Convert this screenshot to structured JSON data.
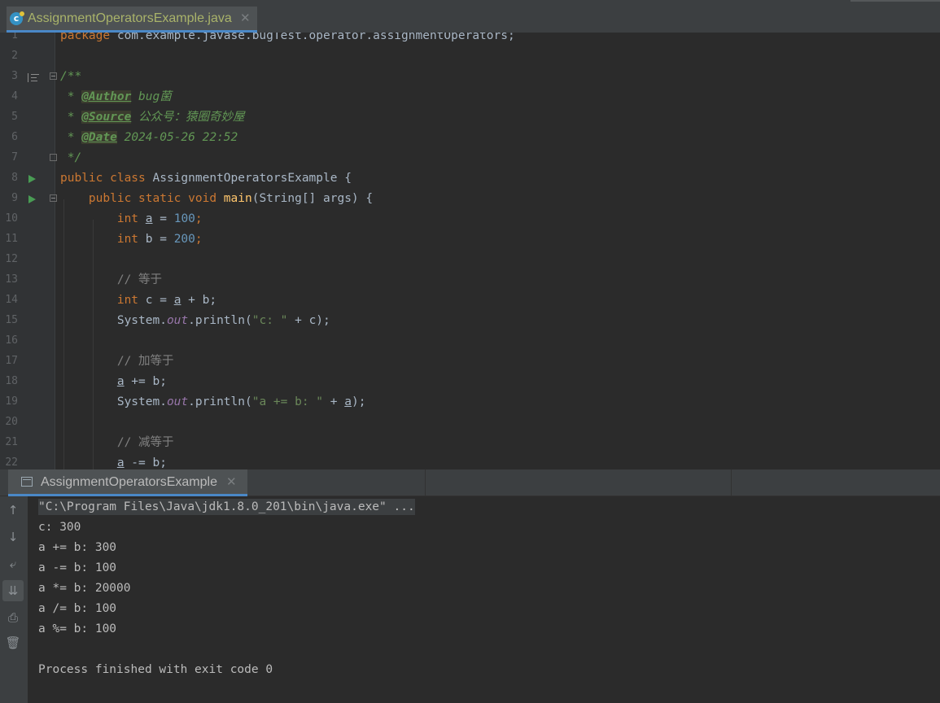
{
  "editor_tab": {
    "title": "AssignmentOperatorsExample.java",
    "close": "✕"
  },
  "code_lines": [
    {
      "n": "1"
    },
    {
      "n": "2"
    },
    {
      "n": "3"
    },
    {
      "n": "4"
    },
    {
      "n": "5"
    },
    {
      "n": "6"
    },
    {
      "n": "7"
    },
    {
      "n": "8"
    },
    {
      "n": "9"
    },
    {
      "n": "10"
    },
    {
      "n": "11"
    },
    {
      "n": "12"
    },
    {
      "n": "13"
    },
    {
      "n": "14"
    },
    {
      "n": "15"
    },
    {
      "n": "16"
    },
    {
      "n": "17"
    },
    {
      "n": "18"
    },
    {
      "n": "19"
    },
    {
      "n": "20"
    },
    {
      "n": "21"
    },
    {
      "n": "22"
    }
  ],
  "code": {
    "l1": {
      "kw": "package",
      "rest": " com.example.javase.bugTest.operator.assignmentOperators;"
    },
    "l3": {
      "doc": "/**"
    },
    "l4": {
      "star": " * ",
      "tag": "@Author",
      "text": " bug菌"
    },
    "l5": {
      "star": " * ",
      "tag": "@Source",
      "text": " 公众号：猿圈奇妙屋"
    },
    "l6": {
      "star": " * ",
      "tag": "@Date",
      "text": " 2024-05-26 22:52"
    },
    "l7": {
      "doc": " */"
    },
    "l8": {
      "kw": "public class",
      "rest": " AssignmentOperatorsExample {"
    },
    "l9": {
      "kw": "public static void",
      "fn": "main",
      "rest": "(String[] args) {"
    },
    "l10": {
      "kw": "int",
      "var": "a",
      "op": " = ",
      "num": "100",
      "end": ";"
    },
    "l11": {
      "kw": "int",
      "rest": " b = ",
      "num": "200",
      "end": ";"
    },
    "l13": {
      "comment": "// 等于"
    },
    "l14": {
      "kw": "int",
      "rest": " c = ",
      "var": "a",
      "rest2": " + b;"
    },
    "l15": {
      "pre": "System.",
      "st": "out",
      "mid": ".println(",
      "str": "\"c: \"",
      "post": " + c);"
    },
    "l17": {
      "comment": "// 加等于"
    },
    "l18": {
      "var": "a",
      "rest": " += b;"
    },
    "l19": {
      "pre": "System.",
      "st": "out",
      "mid": ".println(",
      "str": "\"a += b: \"",
      "post": " + ",
      "var": "a",
      "end": ");"
    },
    "l21": {
      "comment": "// 减等于"
    },
    "l22": {
      "var": "a",
      "rest": " -= b;"
    }
  },
  "console": {
    "tab_title": "AssignmentOperatorsExample",
    "tab_close": "✕",
    "command": "\"C:\\Program Files\\Java\\jdk1.8.0_201\\bin\\java.exe\" ...",
    "output": [
      "c: 300",
      "a += b: 300",
      "a -= b: 100",
      "a *= b: 20000",
      "a /= b: 100",
      "a %= b: 100",
      "",
      "Process finished with exit code 0"
    ],
    "toolbar": [
      {
        "icon": "up-arrow-icon",
        "glyph": "↑"
      },
      {
        "icon": "down-arrow-icon",
        "glyph": "↓"
      },
      {
        "icon": "soft-wrap-icon",
        "glyph": "⤶"
      },
      {
        "icon": "scroll-to-end-icon",
        "glyph": "⇊"
      },
      {
        "icon": "print-icon",
        "glyph": "⎙"
      },
      {
        "icon": "trash-icon",
        "glyph": "🗑"
      }
    ]
  }
}
